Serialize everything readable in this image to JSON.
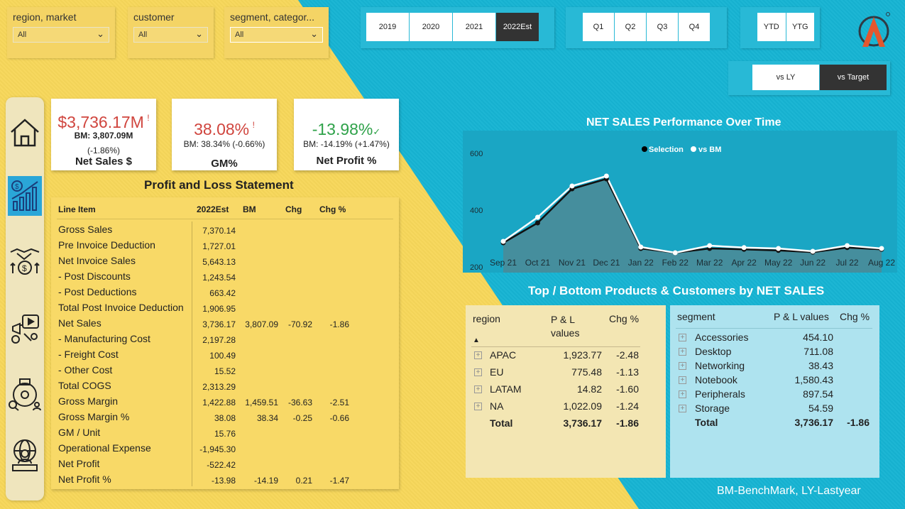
{
  "slicers": [
    {
      "title": "region, market",
      "value": "All"
    },
    {
      "title": "customer",
      "value": "All"
    },
    {
      "title": "segment, categor...",
      "value": "All"
    }
  ],
  "years": [
    "2019",
    "2020",
    "2021",
    "2022Est"
  ],
  "quarters": [
    "Q1",
    "Q2",
    "Q3",
    "Q4"
  ],
  "ytd": [
    "YTD",
    "YTG"
  ],
  "compare": [
    "vs LY",
    "vs Target"
  ],
  "nav_icons": [
    "home-icon",
    "finance-chart-icon",
    "handshake-money-icon",
    "marketing-icon",
    "supply-chain-icon",
    "executive-globe-icon"
  ],
  "kpis": {
    "net_sales": {
      "value": "$3,736.17M",
      "flag": "!",
      "bm": "BM: 3,807.09M",
      "chg": "(-1.86%)",
      "label": "Net Sales $"
    },
    "gm": {
      "value": "38.08%",
      "flag": "!",
      "bm": "BM: 38.34% (-0.66%)",
      "label": "GM%"
    },
    "net_profit": {
      "value": "-13.98%",
      "flag": "✓",
      "bm": "BM: -14.19% (+1.47%)",
      "label": "Net Profit %"
    }
  },
  "colors": {
    "negative": "#d0453e",
    "positive": "#2fa24a",
    "yellow": "#f7d75a",
    "cyan": "#16b4d3"
  },
  "pl": {
    "title": "Profit and Loss Statement",
    "headers": [
      "Line Item",
      "2022Est",
      "BM",
      "Chg",
      "Chg %"
    ],
    "rows": [
      {
        "item": "Gross Sales",
        "est": "7,370.14",
        "bm": "",
        "chg": "",
        "chgp": ""
      },
      {
        "item": "Pre Invoice Deduction",
        "est": "1,727.01",
        "bm": "",
        "chg": "",
        "chgp": ""
      },
      {
        "item": "Net Invoice Sales",
        "est": "5,643.13",
        "bm": "",
        "chg": "",
        "chgp": ""
      },
      {
        "item": " - Post Discounts",
        "est": "1,243.54",
        "bm": "",
        "chg": "",
        "chgp": ""
      },
      {
        "item": " - Post Deductions",
        "est": "663.42",
        "bm": "",
        "chg": "",
        "chgp": ""
      },
      {
        "item": "Total Post Invoice Deduction",
        "est": "1,906.95",
        "bm": "",
        "chg": "",
        "chgp": ""
      },
      {
        "item": "Net Sales",
        "est": "3,736.17",
        "bm": "3,807.09",
        "chg": "-70.92",
        "chgp": "-1.86"
      },
      {
        "item": " - Manufacturing Cost",
        "est": "2,197.28",
        "bm": "",
        "chg": "",
        "chgp": ""
      },
      {
        "item": " - Freight Cost",
        "est": "100.49",
        "bm": "",
        "chg": "",
        "chgp": ""
      },
      {
        "item": " - Other Cost",
        "est": "15.52",
        "bm": "",
        "chg": "",
        "chgp": ""
      },
      {
        "item": "Total COGS",
        "est": "2,313.29",
        "bm": "",
        "chg": "",
        "chgp": ""
      },
      {
        "item": "Gross Margin",
        "est": "1,422.88",
        "bm": "1,459.51",
        "chg": "-36.63",
        "chgp": "-2.51"
      },
      {
        "item": "Gross Margin %",
        "est": "38.08",
        "bm": "38.34",
        "chg": "-0.25",
        "chgp": "-0.66"
      },
      {
        "item": "GM / Unit",
        "est": "15.76",
        "bm": "",
        "chg": "",
        "chgp": ""
      },
      {
        "item": "Operational Expense",
        "est": "-1,945.30",
        "bm": "",
        "chg": "",
        "chgp": ""
      },
      {
        "item": "Net Profit",
        "est": "-522.42",
        "bm": "",
        "chg": "",
        "chgp": ""
      },
      {
        "item": "Net Profit %",
        "est": "-13.98",
        "bm": "-14.19",
        "chg": "0.21",
        "chgp": "-1.47"
      }
    ]
  },
  "chart_data": {
    "type": "area",
    "title": "NET SALES Performance Over Time",
    "legend": [
      "Selection",
      "vs BM"
    ],
    "legend_position": "top-center",
    "x": [
      "Sep 21",
      "Oct 21",
      "Nov 21",
      "Dec 21",
      "Jan 22",
      "Feb 22",
      "Mar 22",
      "Apr 22",
      "May 22",
      "Jun 22",
      "Jul 22",
      "Aug 22"
    ],
    "yticks": [
      "200",
      "400",
      "600"
    ],
    "ylim": [
      180,
      680
    ],
    "series": [
      {
        "name": "Selection",
        "values": [
          285,
          355,
          475,
          510,
          265,
          250,
          265,
          262,
          258,
          252,
          268,
          262
        ]
      },
      {
        "name": "vs BM",
        "values": [
          290,
          375,
          485,
          520,
          270,
          250,
          275,
          268,
          265,
          255,
          275,
          265
        ]
      }
    ]
  },
  "top_bottom_title": "Top / Bottom Products & Customers by NET SALES",
  "region_table": {
    "headers": [
      "region",
      "P & L values",
      "Chg %"
    ],
    "sort_icon": "▲",
    "rows": [
      {
        "name": "APAC",
        "val": "1,923.77",
        "chg": "-2.48"
      },
      {
        "name": "EU",
        "val": "775.48",
        "chg": "-1.13"
      },
      {
        "name": "LATAM",
        "val": "14.82",
        "chg": "-1.60"
      },
      {
        "name": "NA",
        "val": "1,022.09",
        "chg": "-1.24"
      }
    ],
    "total": {
      "name": "Total",
      "val": "3,736.17",
      "chg": "-1.86"
    }
  },
  "segment_table": {
    "headers": [
      "segment",
      "P & L values",
      "Chg %"
    ],
    "rows": [
      {
        "name": "Accessories",
        "val": "454.10"
      },
      {
        "name": "Desktop",
        "val": "711.08"
      },
      {
        "name": "Networking",
        "val": "38.43"
      },
      {
        "name": "Notebook",
        "val": "1,580.43"
      },
      {
        "name": "Peripherals",
        "val": "897.54"
      },
      {
        "name": "Storage",
        "val": "54.59"
      }
    ],
    "total": {
      "name": "Total",
      "val": "3,736.17",
      "chg": "-1.86"
    }
  },
  "footnote": "BM-BenchMark, LY-Lastyear"
}
